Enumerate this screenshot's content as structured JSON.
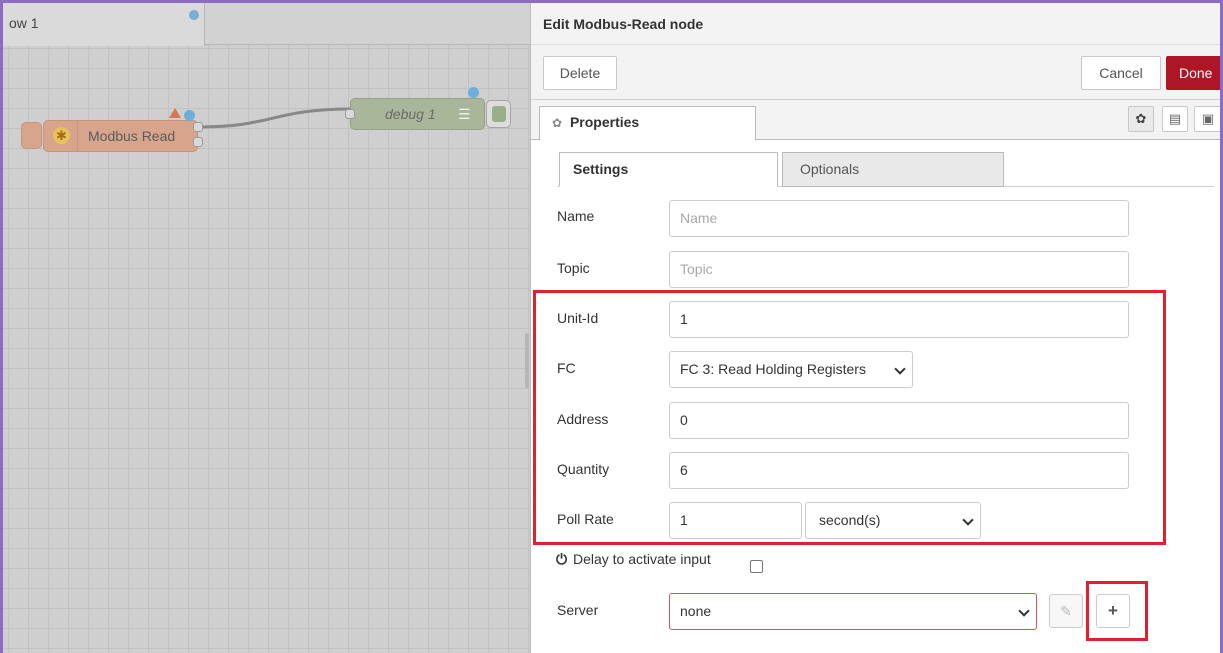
{
  "workspace": {
    "tab_label": "ow 1",
    "nodes": {
      "modbus_read_label": "Modbus Read",
      "debug_label": "debug 1"
    }
  },
  "editor": {
    "title": "Edit Modbus-Read node",
    "toolbar": {
      "delete_label": "Delete",
      "cancel_label": "Cancel",
      "done_label": "Done"
    },
    "tab_label": "Properties",
    "sub_tabs": [
      "Settings",
      "Optionals"
    ],
    "fields": {
      "name": {
        "label": "Name",
        "value": "",
        "placeholder": "Name"
      },
      "topic": {
        "label": "Topic",
        "value": "",
        "placeholder": "Topic"
      },
      "unit_id": {
        "label": "Unit-Id",
        "value": "1"
      },
      "fc": {
        "label": "FC",
        "selected": "FC 3: Read Holding Registers"
      },
      "address": {
        "label": "Address",
        "value": "0"
      },
      "quantity": {
        "label": "Quantity",
        "value": "6"
      },
      "poll_rate": {
        "label": "Poll Rate",
        "value": "1",
        "unit": "second(s)"
      },
      "delay": {
        "label": "Delay to activate input"
      },
      "server": {
        "label": "Server",
        "selected": "none"
      }
    }
  },
  "colors": {
    "done_button": "#ad1625",
    "highlight": "#e0202d",
    "frame": "#8c6bc8"
  },
  "icons": [
    "gear-icon",
    "info-icon",
    "appearance-icon",
    "power-icon",
    "pencil-icon",
    "plus-icon",
    "chevron-down-icon",
    "list-icon"
  ]
}
